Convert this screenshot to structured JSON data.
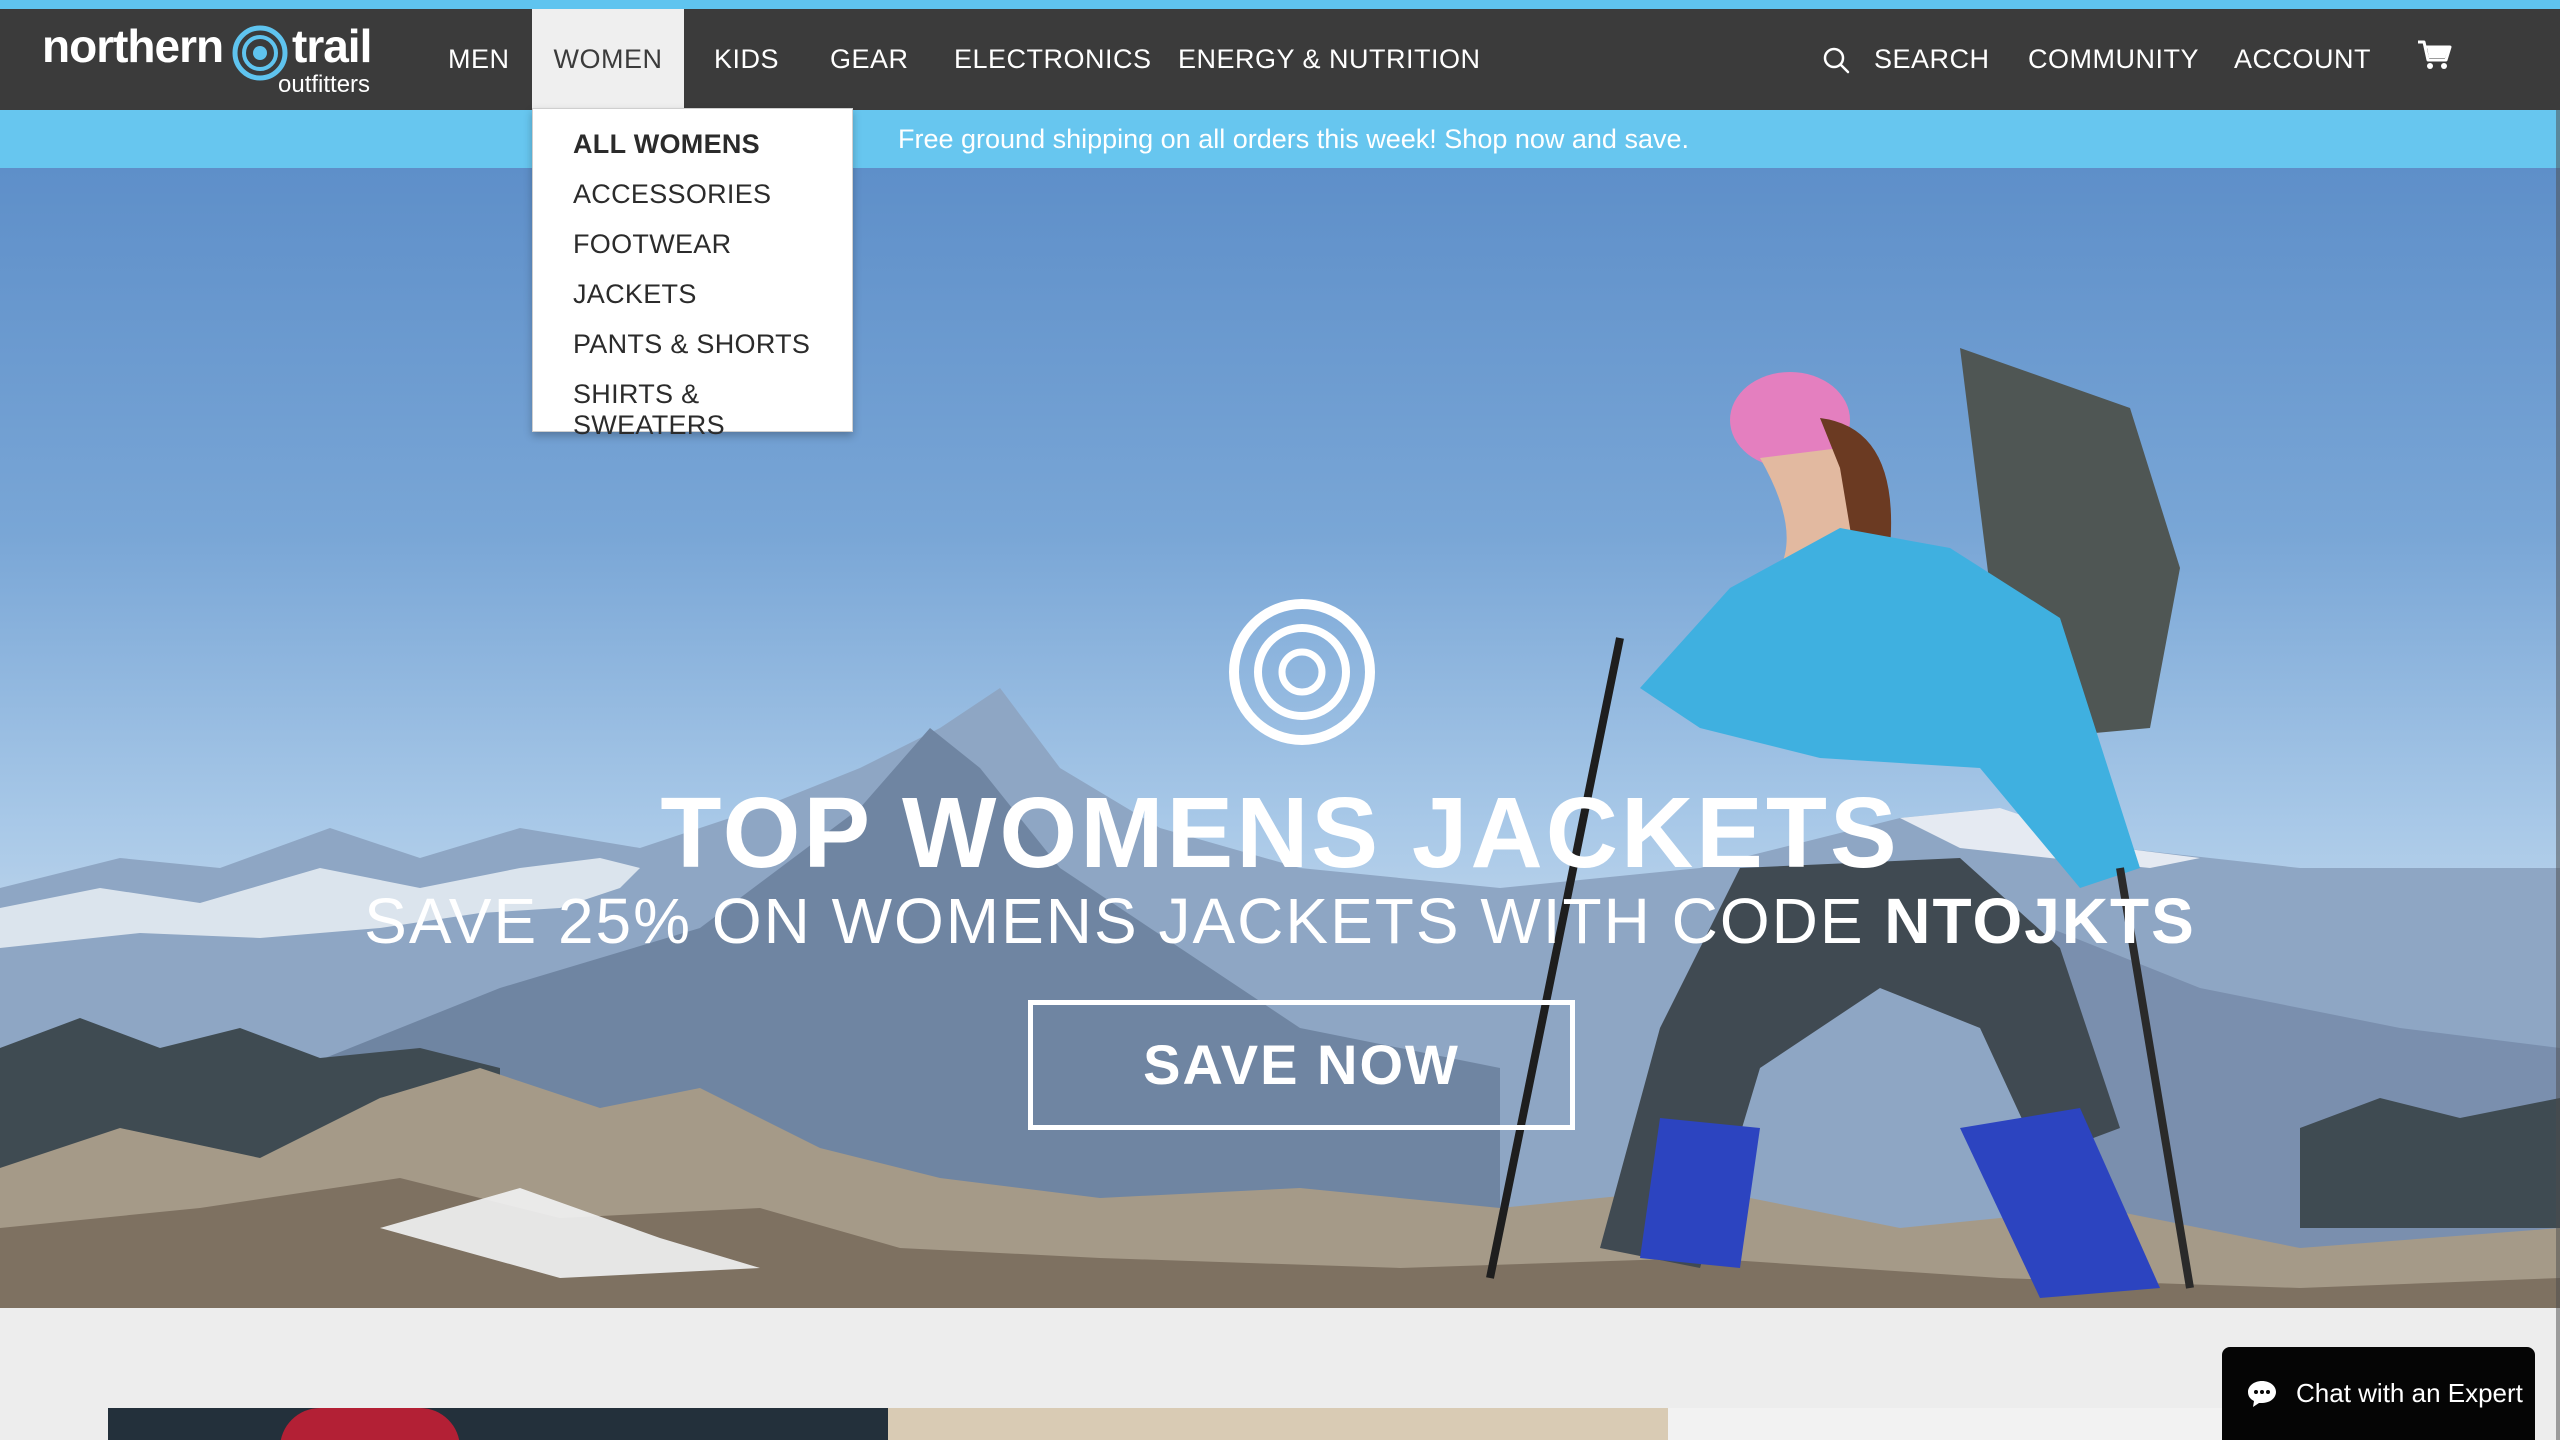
{
  "brand": {
    "name_part1": "northern",
    "name_part2": "trail",
    "name_part3": "outfitters"
  },
  "nav": {
    "items": [
      {
        "label": "MEN"
      },
      {
        "label": "WOMEN"
      },
      {
        "label": "KIDS"
      },
      {
        "label": "GEAR"
      },
      {
        "label": "ELECTRONICS"
      },
      {
        "label": "ENERGY & NUTRITION"
      }
    ],
    "active": "WOMEN",
    "search_label": "SEARCH",
    "community_label": "COMMUNITY",
    "account_label": "ACCOUNT"
  },
  "dropdown": {
    "items": [
      {
        "label": "ALL WOMENS"
      },
      {
        "label": "ACCESSORIES"
      },
      {
        "label": "FOOTWEAR"
      },
      {
        "label": "JACKETS"
      },
      {
        "label": "PANTS & SHORTS"
      },
      {
        "label": "SHIRTS & SWEATERS"
      }
    ]
  },
  "promo": {
    "text": "Free ground shipping on all orders this week! Shop now and save."
  },
  "hero": {
    "title": "TOP WOMENS JACKETS",
    "subtitle_prefix": "SAVE 25% ON WOMENS JACKETS WITH CODE ",
    "code": "NTOJKTS",
    "cta_label": "SAVE NOW"
  },
  "chat": {
    "label": "Chat with an Expert"
  },
  "icons": {
    "search": "search-icon",
    "cart": "cart-icon",
    "chat": "chat-bubble-icon",
    "logo": "logo-swirl-icon"
  },
  "colors": {
    "nav_bg": "#3b3b3b",
    "accent": "#5fc4ef",
    "promo_bg": "#67c6ef",
    "chat_bg": "#050505"
  }
}
